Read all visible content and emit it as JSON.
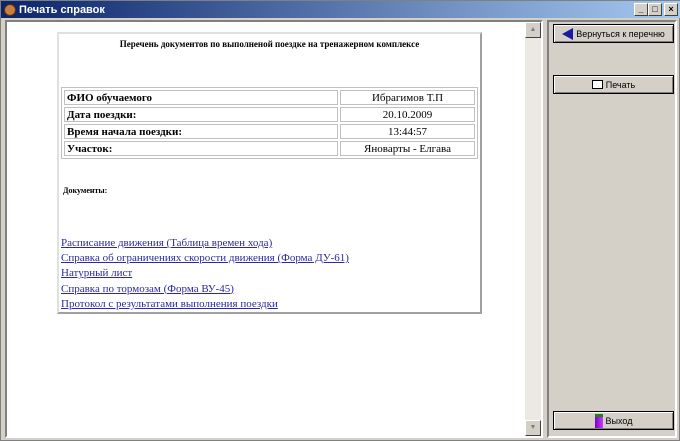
{
  "window": {
    "title": "Печать справок"
  },
  "controls": {
    "minimize": "_",
    "maximize": "□",
    "close": "×"
  },
  "document": {
    "title": "Перечень документов по выполненой поездке на тренажерном комплексе",
    "rows": [
      {
        "label": "ФИО обучаемого",
        "value": "Ибрагимов Т.П"
      },
      {
        "label": "Дата поездки:",
        "value": "20.10.2009"
      },
      {
        "label": "Время начала поездки:",
        "value": "13:44:57"
      },
      {
        "label": "Участок:",
        "value": "Яноварты - Елгава"
      }
    ],
    "documents_label": "Документы:",
    "links": [
      "Расписание движения (Таблица времен хода)",
      "Справка об ограничениях скорости движения (Форма ДУ-61)",
      "Натурный лист",
      "Справка по тормозам (Форма ВУ-45)",
      "Протокол с результатами выполнения поездки"
    ]
  },
  "buttons": {
    "back": "Вернуться к перечню",
    "print": "Печать",
    "exit": "Выход"
  }
}
